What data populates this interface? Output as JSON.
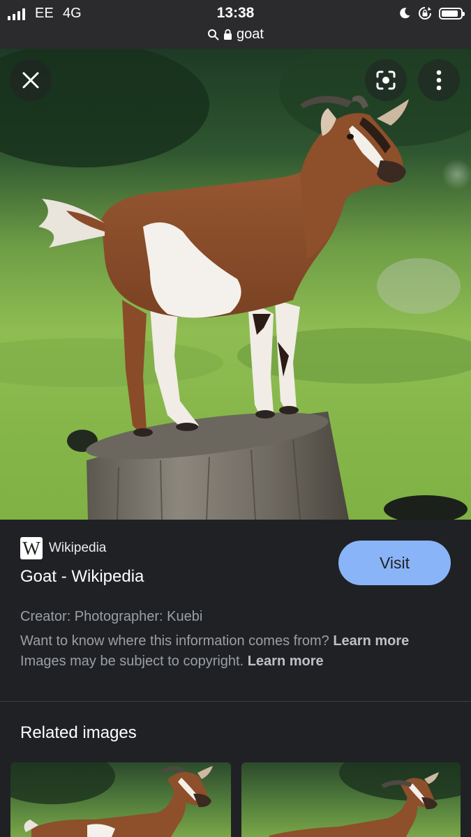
{
  "status_bar": {
    "carrier": "EE",
    "network": "4G",
    "time": "13:38",
    "battery_level": 0.9,
    "url": "goat",
    "icons": [
      "signal-icon",
      "moon-icon",
      "rotation-lock-icon",
      "battery-icon",
      "search-icon",
      "lock-icon"
    ]
  },
  "image_viewer": {
    "image_subject": "goat",
    "buttons": [
      "close-icon",
      "lens-icon",
      "more-vert-icon"
    ]
  },
  "result": {
    "source": "Wikipedia",
    "source_logo_letter": "W",
    "title": "Goat - Wikipedia",
    "visit_label": "Visit",
    "creator": "Creator: Photographer: Kuebi",
    "info_text": "Want to know where this information comes from?",
    "info_link": "Learn more",
    "copyright_text": "Images may be subject to copyright.",
    "copyright_link": "Learn more"
  },
  "related": {
    "title": "Related images"
  },
  "colors": {
    "background": "#202124",
    "status_bar": "#2b2b2d",
    "accent_button": "#8ab4f8",
    "secondary_text": "#9aa0a6"
  }
}
